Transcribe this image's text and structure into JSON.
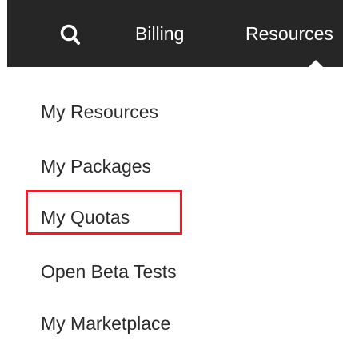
{
  "header": {
    "search_icon": "search-icon",
    "nav": [
      {
        "label": "Billing"
      },
      {
        "label": "Resources"
      }
    ]
  },
  "resources_menu": {
    "items": [
      {
        "label": "My Resources"
      },
      {
        "label": "My Packages"
      },
      {
        "label": "My Quotas",
        "highlighted": true
      },
      {
        "label": "Open Beta Tests"
      },
      {
        "label": "My Marketplace"
      }
    ]
  },
  "colors": {
    "topbar_bg": "#262626",
    "highlight_border": "#e8202a",
    "menu_text": "#2b2b2b"
  }
}
